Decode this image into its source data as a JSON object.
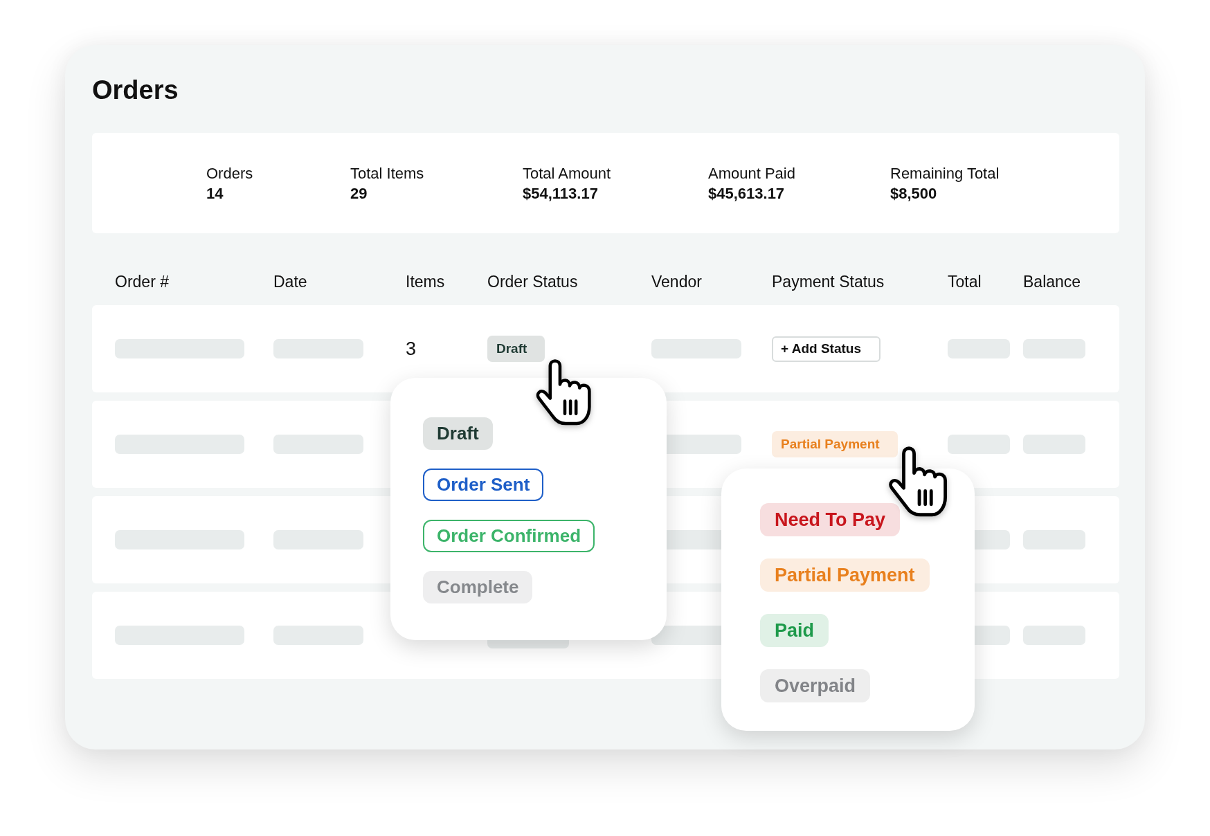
{
  "title": "Orders",
  "summary": [
    {
      "label": "Orders",
      "value": "14"
    },
    {
      "label": "Total Items",
      "value": "29"
    },
    {
      "label": "Total Amount",
      "value": "$54,113.17"
    },
    {
      "label": "Amount Paid",
      "value": "$45,613.17"
    },
    {
      "label": "Remaining Total",
      "value": "$8,500"
    }
  ],
  "table": {
    "columns": [
      "Order #",
      "Date",
      "Items",
      "Order Status",
      "Vendor",
      "Payment Status",
      "Total",
      "Balance"
    ],
    "rows": [
      {
        "cells": [
          {
            "kind": "skeleton"
          },
          {
            "kind": "skeleton"
          },
          {
            "kind": "text",
            "text": "3"
          },
          {
            "kind": "badge",
            "label": "Draft",
            "color": "#1f3a33"
          },
          {
            "kind": "skeleton"
          },
          {
            "kind": "button",
            "label": "+ Add Status"
          },
          {
            "kind": "skeleton"
          },
          {
            "kind": "skeleton"
          }
        ]
      },
      {
        "cells": [
          {
            "kind": "skeleton"
          },
          {
            "kind": "skeleton"
          },
          {
            "kind": "covered"
          },
          {
            "kind": "covered"
          },
          {
            "kind": "skeleton"
          },
          {
            "kind": "badge",
            "label": "Partial Payment",
            "color": "#e8801e"
          },
          {
            "kind": "skeleton"
          },
          {
            "kind": "skeleton"
          }
        ]
      },
      {
        "cells": [
          {
            "kind": "skeleton"
          },
          {
            "kind": "skeleton"
          },
          {
            "kind": "covered"
          },
          {
            "kind": "covered"
          },
          {
            "kind": "skeleton"
          },
          {
            "kind": "covered"
          },
          {
            "kind": "skeleton"
          },
          {
            "kind": "skeleton"
          }
        ]
      },
      {
        "cells": [
          {
            "kind": "skeleton"
          },
          {
            "kind": "skeleton"
          },
          {
            "kind": "covered"
          },
          {
            "kind": "skeleton"
          },
          {
            "kind": "skeleton"
          },
          {
            "kind": "covered"
          },
          {
            "kind": "skeleton"
          },
          {
            "kind": "skeleton"
          }
        ]
      }
    ]
  },
  "order_status_menu": {
    "options": [
      {
        "label": "Draft",
        "kind": "filled",
        "color": "#1f3a33"
      },
      {
        "label": "Order Sent",
        "kind": "outlined",
        "color": "#1f5fc8"
      },
      {
        "label": "Order Confirmed",
        "kind": "outlined",
        "color": "#3cb46a"
      },
      {
        "label": "Complete",
        "kind": "filled",
        "color": "#85888c"
      }
    ]
  },
  "payment_status_menu": {
    "options": [
      {
        "label": "Need To Pay",
        "kind": "filled",
        "color": "#c8161d"
      },
      {
        "label": "Partial Payment",
        "kind": "filled",
        "color": "#e8801e"
      },
      {
        "label": "Paid",
        "kind": "filled",
        "color": "#1e9a4b"
      },
      {
        "label": "Overpaid",
        "kind": "filled",
        "color": "#828488"
      }
    ]
  }
}
